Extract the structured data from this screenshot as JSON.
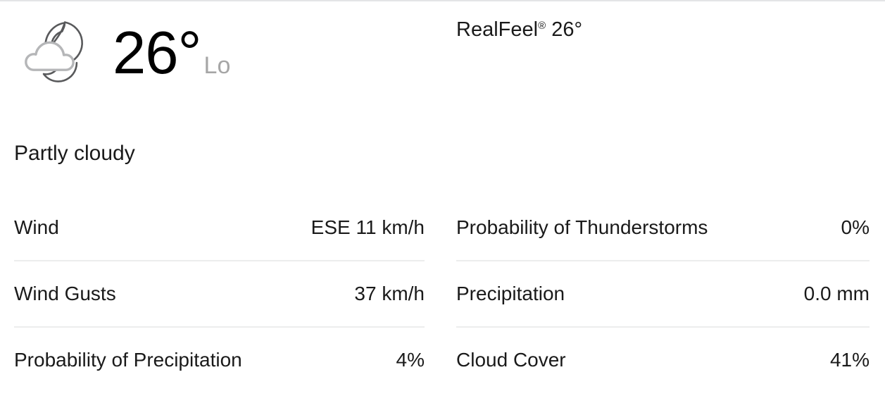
{
  "theme": {
    "background": "#ffffff",
    "text_primary": "#1a1a1a",
    "text_muted": "#a6a6a6",
    "divider": "#eceded",
    "top_border": "#e3e4e6",
    "icon_moon": "#58595b",
    "icon_cloud": "#b5b6b8"
  },
  "current": {
    "icon": "moon-with-cloud-icon",
    "temperature": "26°",
    "qualifier": "Lo",
    "realfeel_label": "RealFeel",
    "realfeel_registered": "®",
    "realfeel_value": "26°",
    "phrase": "Partly cloudy"
  },
  "details": {
    "left_column": [
      {
        "label": "Wind",
        "value": "ESE 11 km/h"
      },
      {
        "label": "Wind Gusts",
        "value": "37 km/h"
      },
      {
        "label": "Probability of Precipitation",
        "value": "4%"
      }
    ],
    "right_column": [
      {
        "label": "Probability of Thunderstorms",
        "value": "0%"
      },
      {
        "label": "Precipitation",
        "value": "0.0 mm"
      },
      {
        "label": "Cloud Cover",
        "value": "41%"
      }
    ]
  }
}
